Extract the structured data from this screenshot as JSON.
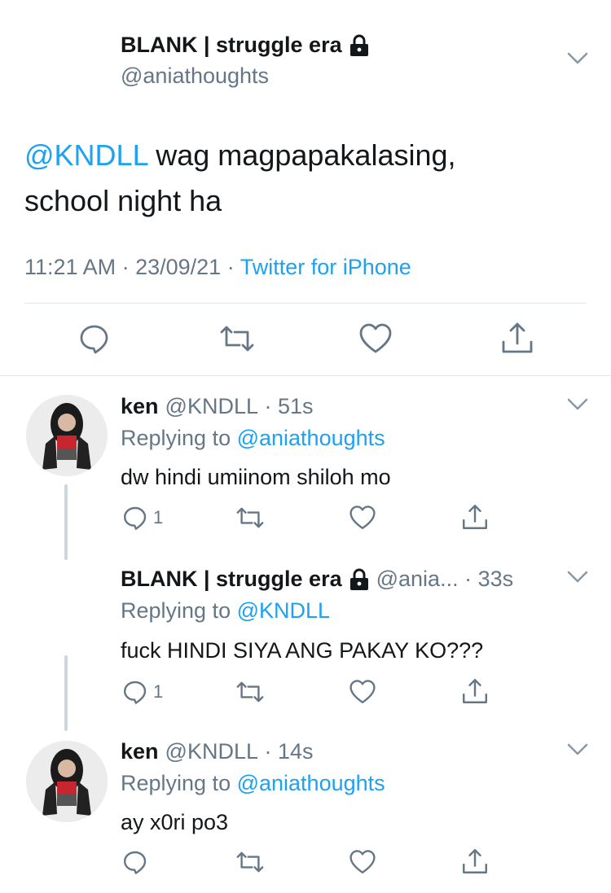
{
  "main_tweet": {
    "display_name": "BLANK | struggle era",
    "handle": "@aniathoughts",
    "mention": "@KNDLL",
    "text_line1": " wag magpapakalasing,",
    "text_line2": "school night ha",
    "time": "11:21 AM",
    "date": "23/09/21",
    "separator": " · ",
    "source": "Twitter for iPhone"
  },
  "replies": [
    {
      "display_name": "ken",
      "handle": "@KNDLL",
      "dot": " · ",
      "time": "51s",
      "replying_prefix": "Replying to ",
      "replying_to": "@aniathoughts",
      "text": "dw hindi umiinom shiloh mo",
      "reply_count": "1"
    },
    {
      "display_name": "BLANK | struggle era",
      "handle": "@ania...",
      "dot": " · ",
      "time": "33s",
      "replying_prefix": "Replying to ",
      "replying_to": "@KNDLL",
      "text": "fuck HINDI SIYA ANG PAKAY KO???",
      "reply_count": "1"
    },
    {
      "display_name": "ken",
      "handle": "@KNDLL",
      "dot": " · ",
      "time": "14s",
      "replying_prefix": "Replying to ",
      "replying_to": "@aniathoughts",
      "text": "ay x0ri po3",
      "reply_count": ""
    }
  ],
  "icons": {
    "reply": "reply-icon",
    "retweet": "retweet-icon",
    "like": "heart-icon",
    "share": "share-icon",
    "more": "chevron-down-icon",
    "lock": "lock-icon"
  },
  "colors": {
    "link": "#1da1f2",
    "secondary": "#657786",
    "text": "#14171a",
    "divider": "#e1e8ed"
  }
}
